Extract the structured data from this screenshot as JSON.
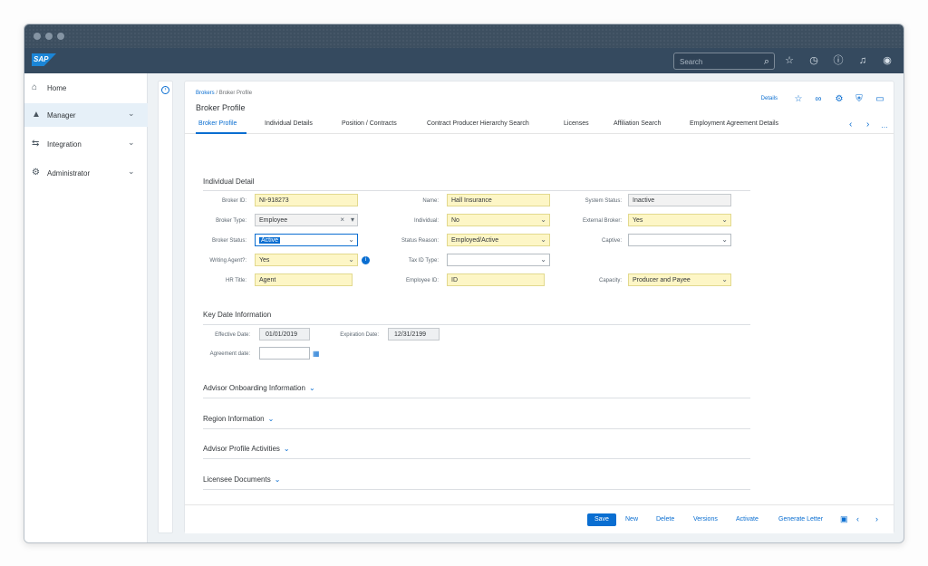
{
  "shell": {
    "logo": "SAP",
    "search_placeholder": "Search",
    "icons": [
      "search-icon",
      "star-icon",
      "history-icon",
      "help-icon",
      "bell-icon",
      "user-icon"
    ]
  },
  "sidebar": {
    "items": [
      {
        "label": "Home",
        "icon": "home-icon"
      },
      {
        "label": "Manager",
        "icon": "manager-icon"
      },
      {
        "label": "Integration",
        "icon": "integration-icon"
      },
      {
        "label": "Administrator",
        "icon": "administrator-icon"
      }
    ]
  },
  "header": {
    "breadcrumb_root": "Brokers",
    "breadcrumb_sep": " / ",
    "breadcrumb_current": "Broker Profile",
    "title": "Broker Profile",
    "details_label": "Details"
  },
  "tabs": [
    "Broker Profile",
    "Individual Details",
    "Position / Contracts",
    "Contract Producer Hierarchy Search",
    "Licenses",
    "Affiliation Search",
    "Employment Agreement Details"
  ],
  "individual": {
    "title": "Individual Detail",
    "broker_id_label": "Broker ID:",
    "broker_id": "NI-918273",
    "name_label": "Name:",
    "name": "Hall Insurance",
    "system_status_label": "System Status:",
    "system_status": "Inactive",
    "broker_type_label": "Broker Type:",
    "broker_type": "Employee",
    "individual_label": "Individual:",
    "individual": "No",
    "external_broker_label": "External Broker:",
    "external_broker": "Yes",
    "broker_status_label": "Broker Status:",
    "broker_status": "Active",
    "status_reason_label": "Status Reason:",
    "status_reason": "Employed/Active",
    "captive_label": "Captive:",
    "captive": "",
    "writing_agent_label": "Writing Agent?:",
    "writing_agent": "Yes",
    "tax_id_type_label": "Tax ID Type:",
    "tax_id_type": "",
    "hr_title_label": "HR Title:",
    "hr_title": "Agent",
    "employee_id_label": "Employee ID:",
    "employee_id": "ID",
    "capacity_label": "Capacity:",
    "capacity": "Producer and Payee"
  },
  "key_dates": {
    "title": "Key Date Information",
    "effective_label": "Effective Date:",
    "effective": "01/01/2019",
    "expiration_label": "Expiration Date:",
    "expiration": "12/31/2199",
    "agreement_label": "Agreement date:",
    "agreement": ""
  },
  "sections": [
    "Advisor Onboarding Information",
    "Region Information",
    "Advisor Profile Activities",
    "Licensee Documents"
  ],
  "footer": {
    "save": "Save",
    "new": "New",
    "delete": "Delete",
    "versions": "Versions",
    "activate": "Activate",
    "generate_letter": "Generate Letter"
  }
}
